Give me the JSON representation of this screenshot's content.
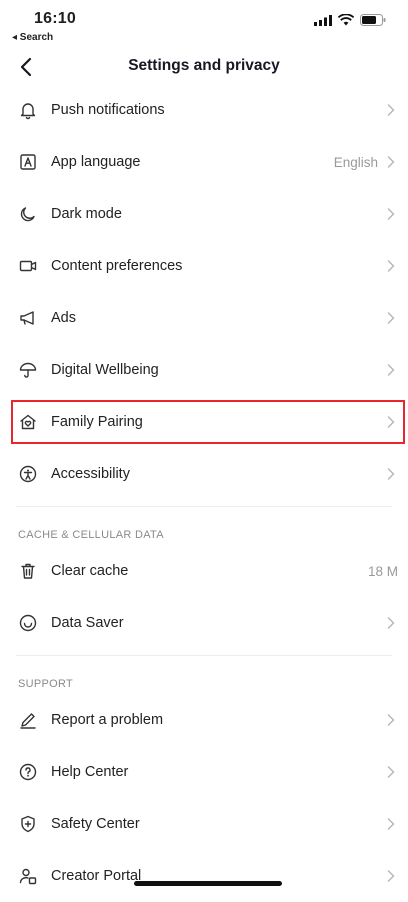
{
  "status": {
    "time": "16:10",
    "back_app": "◂ Search"
  },
  "nav": {
    "title": "Settings and privacy"
  },
  "rows_top": [
    {
      "key": "push",
      "label": "Push notifications",
      "icon": "bell-icon",
      "value": ""
    },
    {
      "key": "language",
      "label": "App language",
      "icon": "language-icon",
      "value": "English"
    },
    {
      "key": "dark",
      "label": "Dark mode",
      "icon": "moon-icon",
      "value": ""
    },
    {
      "key": "content",
      "label": "Content preferences",
      "icon": "video-icon",
      "value": ""
    },
    {
      "key": "ads",
      "label": "Ads",
      "icon": "megaphone-icon",
      "value": ""
    },
    {
      "key": "wellbeing",
      "label": "Digital Wellbeing",
      "icon": "umbrella-icon",
      "value": ""
    },
    {
      "key": "family",
      "label": "Family Pairing",
      "icon": "home-heart-icon",
      "value": "",
      "highlighted": true
    },
    {
      "key": "accessibility",
      "label": "Accessibility",
      "icon": "accessibility-icon",
      "value": ""
    }
  ],
  "section_cache": {
    "title": "CACHE & CELLULAR DATA"
  },
  "rows_cache": [
    {
      "key": "clear",
      "label": "Clear cache",
      "icon": "trash-icon",
      "value": "18 M"
    },
    {
      "key": "saver",
      "label": "Data Saver",
      "icon": "data-saver-icon",
      "value": ""
    }
  ],
  "section_support": {
    "title": "SUPPORT"
  },
  "rows_support": [
    {
      "key": "report",
      "label": "Report a problem",
      "icon": "pencil-icon",
      "value": ""
    },
    {
      "key": "help",
      "label": "Help Center",
      "icon": "question-icon",
      "value": ""
    },
    {
      "key": "safety",
      "label": "Safety Center",
      "icon": "shield-icon",
      "value": ""
    },
    {
      "key": "creator",
      "label": "Creator Portal",
      "icon": "creator-icon",
      "value": ""
    }
  ],
  "colors": {
    "highlight_border": "#e8262e",
    "text": "#222222",
    "muted": "#9a9a9a"
  }
}
